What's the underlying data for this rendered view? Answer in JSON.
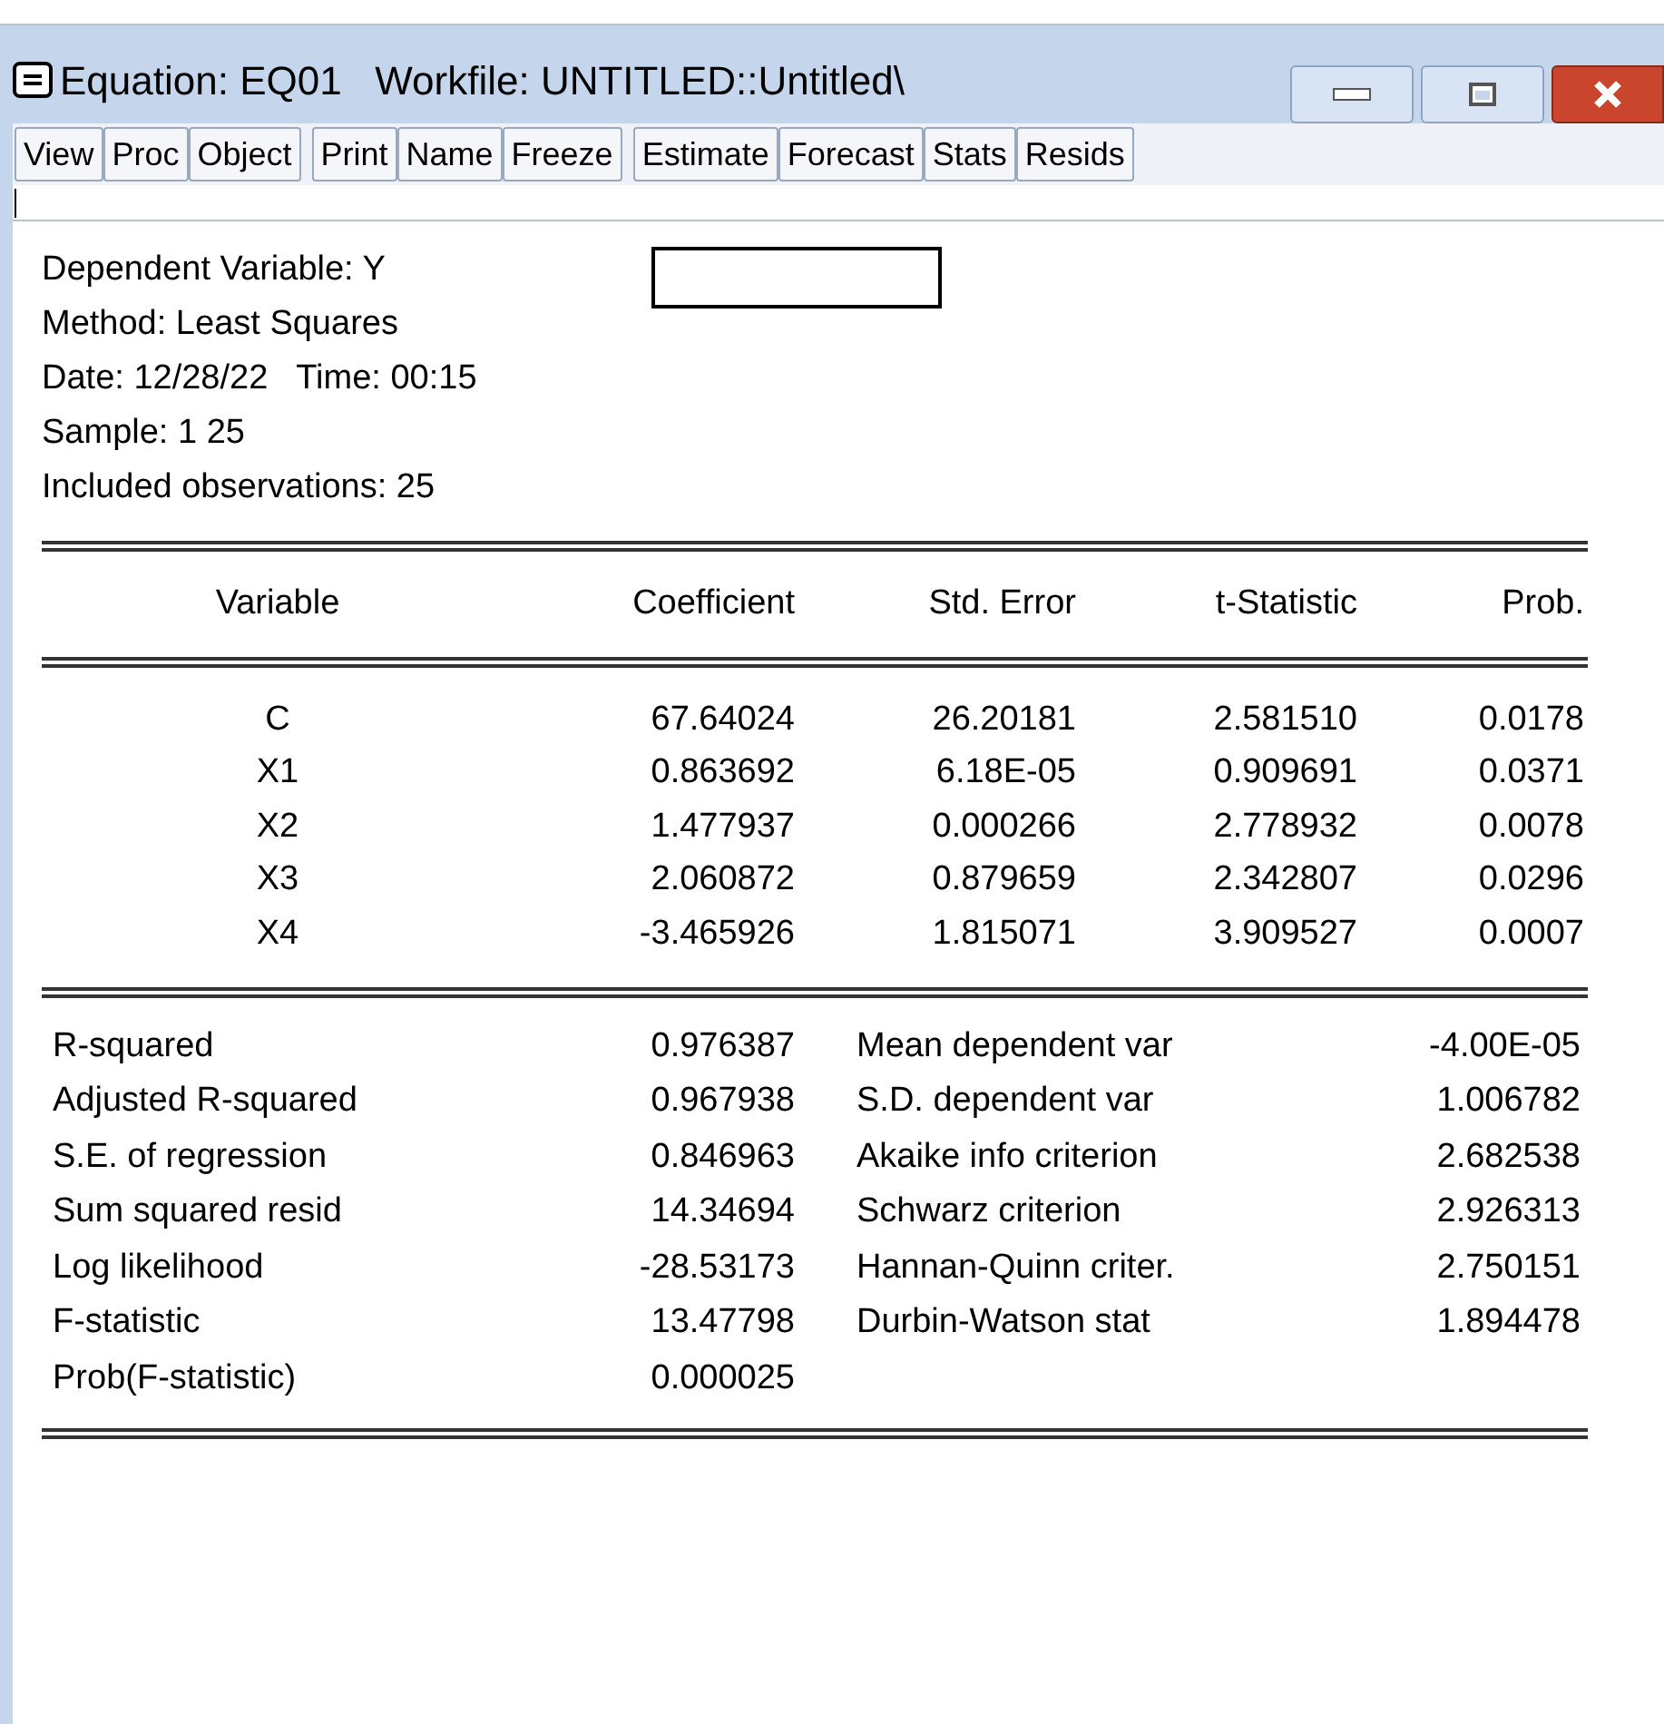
{
  "window": {
    "title": "Equation: EQ01   Workfile: UNTITLED::Untitled\\"
  },
  "toolbar": [
    [
      "View",
      "Proc",
      "Object"
    ],
    [
      "Print",
      "Name",
      "Freeze"
    ],
    [
      "Estimate",
      "Forecast",
      "Stats",
      "Resids"
    ]
  ],
  "header_lines": [
    "Dependent Variable: Y",
    "Method: Least Squares",
    "Date: 12/28/22   Time: 00:15",
    "Sample: 1 25",
    "Included observations: 25"
  ],
  "table": {
    "columns": [
      "Variable",
      "Coefficient",
      "Std. Error",
      "t-Statistic",
      "Prob."
    ],
    "rows": [
      [
        "C",
        "67.64024",
        "26.20181",
        "2.581510",
        "0.0178"
      ],
      [
        "X1",
        "0.863692",
        "6.18E-05",
        "0.909691",
        "0.0371"
      ],
      [
        "X2",
        "1.477937",
        "0.000266",
        "2.778932",
        "0.0078"
      ],
      [
        "X3",
        "2.060872",
        "0.879659",
        "2.342807",
        "0.0296"
      ],
      [
        "X4",
        "-3.465926",
        "1.815071",
        "3.909527",
        "0.0007"
      ]
    ]
  },
  "stats": [
    [
      "R-squared",
      "0.976387",
      "Mean dependent var",
      "-4.00E-05"
    ],
    [
      "Adjusted R-squared",
      "0.967938",
      "S.D. dependent var",
      "1.006782"
    ],
    [
      "S.E. of regression",
      "0.846963",
      "Akaike info criterion",
      "2.682538"
    ],
    [
      "Sum squared resid",
      "14.34694",
      "Schwarz criterion",
      "2.926313"
    ],
    [
      "Log likelihood",
      "-28.53173",
      "Hannan-Quinn criter.",
      "2.750151"
    ],
    [
      "F-statistic",
      "13.47798",
      "Durbin-Watson stat",
      "1.894478"
    ],
    [
      "Prob(F-statistic)",
      "0.000025"
    ]
  ]
}
